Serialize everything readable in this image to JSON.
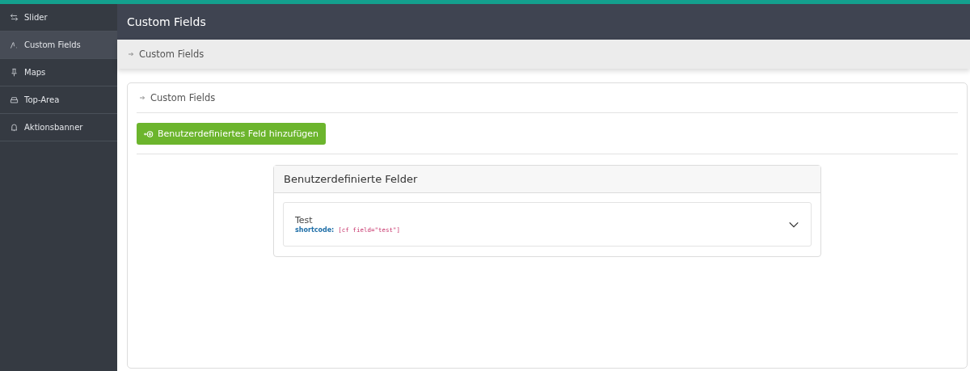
{
  "sidebar": {
    "items": [
      {
        "label": "Slider",
        "selected": false
      },
      {
        "label": "Custom Fields",
        "selected": true
      },
      {
        "label": "Maps",
        "selected": false
      },
      {
        "label": "Top-Area",
        "selected": false
      },
      {
        "label": "Aktionsbanner",
        "selected": false
      }
    ]
  },
  "header": {
    "title": "Custom Fields"
  },
  "breadcrumb": {
    "label": "Custom Fields"
  },
  "card": {
    "breadcrumb": "Custom Fields",
    "add_button": "Benutzerdefiniertes Feld hinzufügen",
    "panel": {
      "title": "Benutzerdefinierte Felder",
      "fields": [
        {
          "name": "Test",
          "shortcode_label": "shortcode:",
          "shortcode": "[cf field=\"test\"]",
          "expanded": false
        }
      ]
    }
  }
}
